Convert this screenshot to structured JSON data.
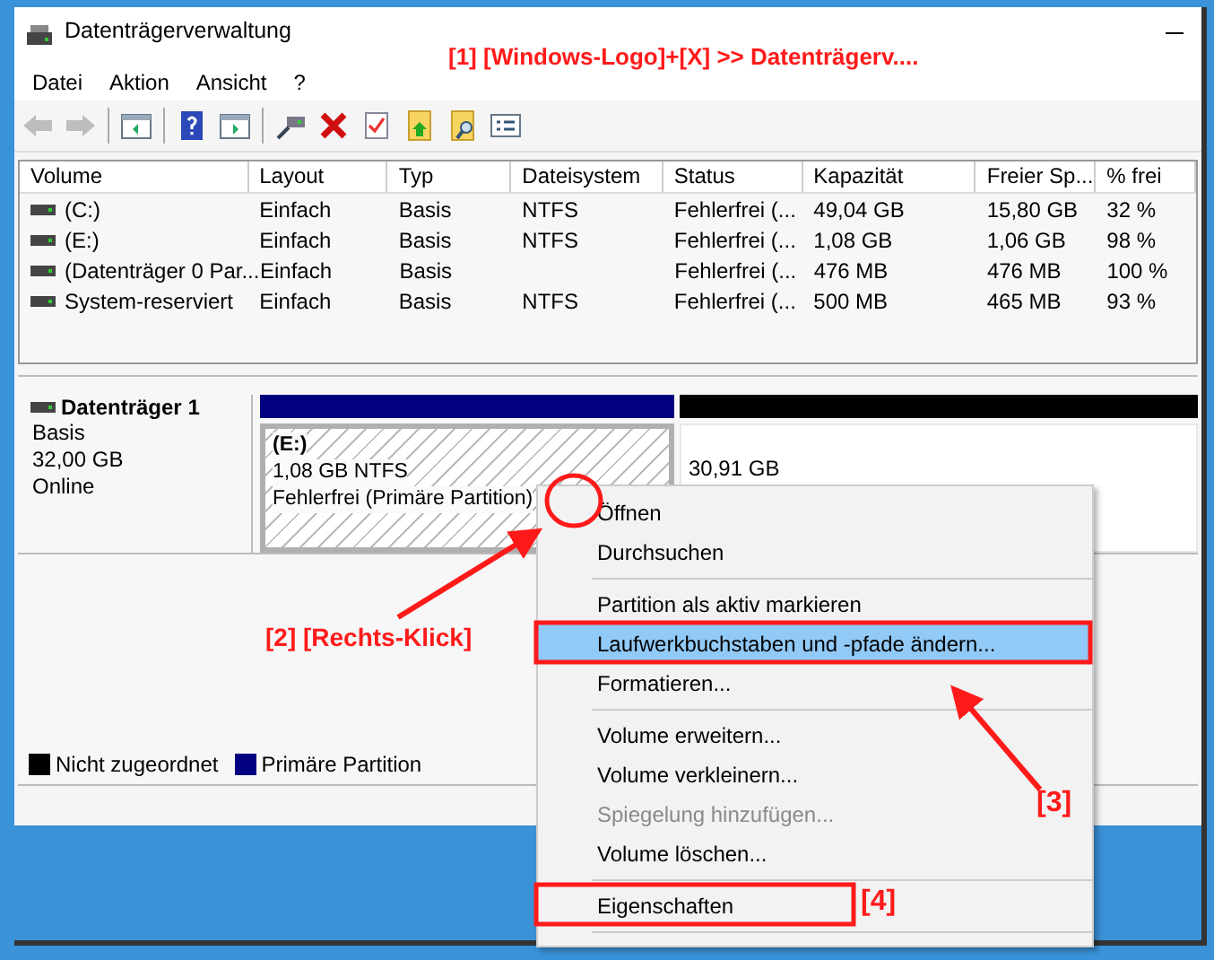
{
  "window": {
    "title": "Datenträgerverwaltung"
  },
  "menu_bar": [
    "Datei",
    "Aktion",
    "Ansicht",
    "?"
  ],
  "toolbar": [
    {
      "kind": "back",
      "disabled": true
    },
    {
      "kind": "forward",
      "disabled": true
    },
    {
      "kind": "console",
      "disabled": false
    },
    {
      "kind": "help",
      "disabled": false
    },
    {
      "kind": "view",
      "disabled": false
    },
    {
      "kind": "connect",
      "disabled": false
    },
    {
      "kind": "delete",
      "disabled": false
    },
    {
      "kind": "check",
      "disabled": false
    },
    {
      "kind": "folder-up",
      "disabled": false
    },
    {
      "kind": "folder-search",
      "disabled": false
    },
    {
      "kind": "list",
      "disabled": false
    }
  ],
  "table": {
    "columns": [
      "Volume",
      "Layout",
      "Typ",
      "Dateisystem",
      "Status",
      "Kapazität",
      "Freier Sp...",
      "% frei"
    ],
    "rows": [
      [
        "(C:)",
        "Einfach",
        "Basis",
        "NTFS",
        "Fehlerfrei (...",
        "49,04 GB",
        "15,80 GB",
        "32 %"
      ],
      [
        "(E:)",
        "Einfach",
        "Basis",
        "NTFS",
        "Fehlerfrei (...",
        "1,08 GB",
        "1,06 GB",
        "98 %"
      ],
      [
        "(Datenträger 0 Par...",
        "Einfach",
        "Basis",
        "",
        "Fehlerfrei (...",
        "476 MB",
        "476 MB",
        "100 %"
      ],
      [
        "System-reserviert",
        "Einfach",
        "Basis",
        "NTFS",
        "Fehlerfrei (...",
        "500 MB",
        "465 MB",
        "93 %"
      ]
    ]
  },
  "disk": {
    "name": "Datenträger 1",
    "type": "Basis",
    "size": "32,00 GB",
    "status": "Online",
    "partitions": [
      {
        "kind": "primary",
        "color": "#000080",
        "title": "(E:)",
        "size": "1,08 GB NTFS",
        "status": "Fehlerfrei (Primäre Partition)"
      },
      {
        "kind": "unallocated",
        "color": "#000000",
        "size": "30,91 GB"
      }
    ]
  },
  "legend": [
    {
      "label": "Nicht zugeordnet",
      "color": "#000000"
    },
    {
      "label": "Primäre Partition",
      "color": "#000080"
    }
  ],
  "context_menu": [
    {
      "kind": "item",
      "label": "Öffnen",
      "selected": false,
      "disabled": false
    },
    {
      "kind": "item",
      "label": "Durchsuchen",
      "selected": false,
      "disabled": false
    },
    {
      "kind": "separator"
    },
    {
      "kind": "item",
      "label": "Partition als aktiv markieren",
      "selected": false,
      "disabled": false
    },
    {
      "kind": "item",
      "label": "Laufwerkbuchstaben und -pfade ändern...",
      "selected": true,
      "disabled": false
    },
    {
      "kind": "item",
      "label": "Formatieren...",
      "selected": false,
      "disabled": false
    },
    {
      "kind": "separator"
    },
    {
      "kind": "item",
      "label": "Volume erweitern...",
      "selected": false,
      "disabled": false
    },
    {
      "kind": "item",
      "label": "Volume verkleinern...",
      "selected": false,
      "disabled": false
    },
    {
      "kind": "item",
      "label": "Spiegelung hinzufügen...",
      "selected": false,
      "disabled": true
    },
    {
      "kind": "item",
      "label": "Volume löschen...",
      "selected": false,
      "disabled": false
    },
    {
      "kind": "separator"
    },
    {
      "kind": "item",
      "label": "Eigenschaften",
      "selected": false,
      "disabled": false
    },
    {
      "kind": "separator"
    }
  ],
  "annotations": [
    "[1] [Windows-Logo]+[X] >> Datenträgerv....",
    "[2] [Rechts-Klick]",
    "[3]",
    "[4]"
  ]
}
